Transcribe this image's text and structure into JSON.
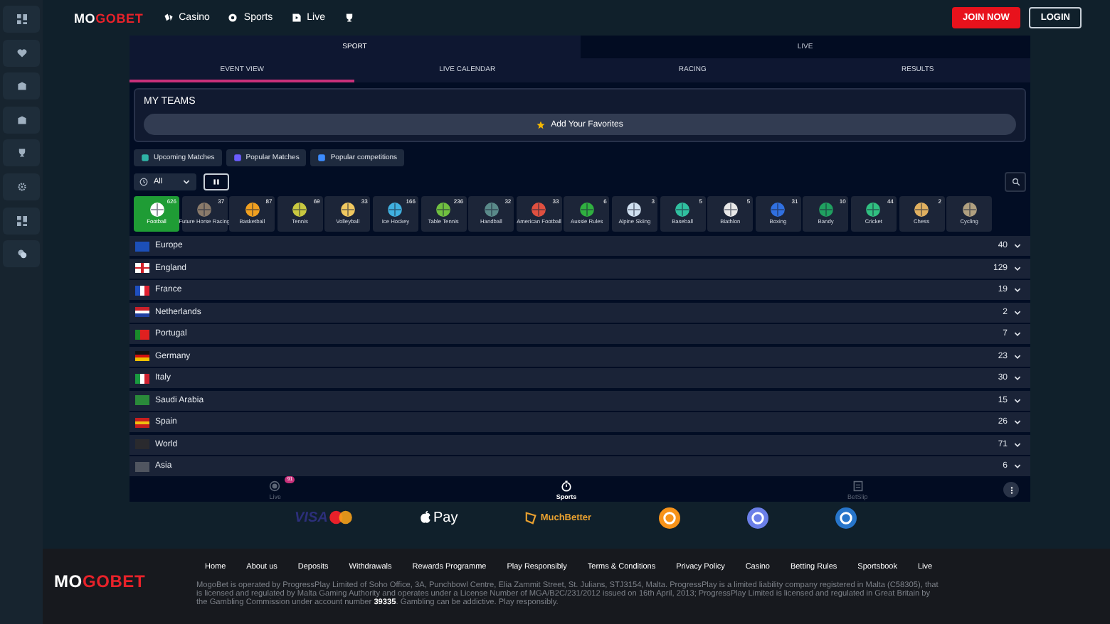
{
  "top_bar": {
    "logo": {
      "light": "MO",
      "accent": "GOBET"
    },
    "nav": [
      {
        "kind": "link",
        "label": "Casino"
      },
      {
        "kind": "link",
        "label": "Sports"
      },
      {
        "kind": "link",
        "label": "Live"
      },
      {
        "kind": "icon"
      }
    ],
    "buttons": [
      {
        "kind": "primary",
        "label": "JOIN NOW"
      },
      {
        "kind": "outline",
        "label": "LOGIN"
      }
    ]
  },
  "main_tabs": [
    {
      "label": "SPORT",
      "selected": true
    },
    {
      "label": "LIVE",
      "selected": false
    }
  ],
  "sub_tabs": [
    {
      "label": "EVENT VIEW",
      "selected": true
    },
    {
      "label": "LIVE CALENDAR",
      "selected": false
    },
    {
      "label": "RACING",
      "selected": false
    },
    {
      "label": "RESULTS",
      "selected": false
    }
  ],
  "my_teams": {
    "title": "MY TEAMS",
    "button": "Add Your Favorites"
  },
  "quick_filters": [
    {
      "label": "Upcoming Matches",
      "color": "#2fb3a6"
    },
    {
      "label": "Popular Matches",
      "color": "#6b5cff"
    },
    {
      "label": "Popular competitions",
      "color": "#3c8cff"
    }
  ],
  "time_filter": {
    "value": "All"
  },
  "sports": [
    {
      "name": "Football",
      "count": "626",
      "color": "#ffffff",
      "selected": true
    },
    {
      "name": "Future Horse Racing",
      "count": "37",
      "color": "#8a7a6a",
      "selected": false
    },
    {
      "name": "Basketball",
      "count": "87",
      "color": "#f0a020",
      "selected": false
    },
    {
      "name": "Tennis",
      "count": "69",
      "color": "#c8c840",
      "selected": false
    },
    {
      "name": "Volleyball",
      "count": "33",
      "color": "#f0c860",
      "selected": false
    },
    {
      "name": "Ice Hockey",
      "count": "166",
      "color": "#40b0e0",
      "selected": false
    },
    {
      "name": "Table Tennis",
      "count": "236",
      "color": "#70c040",
      "selected": false
    },
    {
      "name": "Handball",
      "count": "32",
      "color": "#5a8a8a",
      "selected": false
    },
    {
      "name": "American Football",
      "count": "33",
      "color": "#e05040",
      "selected": false
    },
    {
      "name": "Aussie Rules",
      "count": "6",
      "color": "#30b040",
      "selected": false
    },
    {
      "name": "Alpine Skiing",
      "count": "3",
      "color": "#d0e0f0",
      "selected": false
    },
    {
      "name": "Baseball",
      "count": "5",
      "color": "#30c0a0",
      "selected": false
    },
    {
      "name": "Biathlon",
      "count": "5",
      "color": "#e8e8e8",
      "selected": false
    },
    {
      "name": "Boxing",
      "count": "31",
      "color": "#3070e0",
      "selected": false
    },
    {
      "name": "Bandy",
      "count": "10",
      "color": "#20a060",
      "selected": false
    },
    {
      "name": "Cricket",
      "count": "44",
      "color": "#30c080",
      "selected": false
    },
    {
      "name": "Chess",
      "count": "2",
      "color": "#e0b060",
      "selected": false
    },
    {
      "name": "Cycling",
      "color": "#b0a080",
      "selected": false
    }
  ],
  "regions": [
    {
      "kind": "eu",
      "name": "Europe",
      "count": "40"
    },
    {
      "kind": "england",
      "name": "England",
      "count": "129"
    },
    {
      "kind": "france",
      "name": "France",
      "count": "19"
    },
    {
      "kind": "netherlands",
      "name": "Netherlands",
      "count": "2"
    },
    {
      "kind": "portugal",
      "name": "Portugal",
      "count": "7"
    },
    {
      "kind": "germany",
      "name": "Germany",
      "count": "23"
    },
    {
      "kind": "italy",
      "name": "Italy",
      "count": "30"
    },
    {
      "kind": "saudi",
      "name": "Saudi Arabia",
      "count": "15"
    },
    {
      "kind": "spain",
      "name": "Spain",
      "count": "26"
    },
    {
      "kind": "world",
      "name": "World",
      "count": "71"
    },
    {
      "kind": "asia",
      "name": "Asia",
      "count": "6"
    }
  ],
  "bottom_nav": [
    {
      "label": "Live",
      "badge": "91",
      "selected": false
    },
    {
      "label": "Sports",
      "selected": true
    },
    {
      "label": "BetSlip",
      "selected": false
    }
  ],
  "payments": [
    {
      "kind": "visa",
      "label": "VISA"
    },
    {
      "kind": "applepay",
      "label": "Pay"
    },
    {
      "kind": "muchbetter",
      "label": "MuchBetter"
    },
    {
      "kind": "coin",
      "color": "#f7931a"
    },
    {
      "kind": "coin",
      "color": "#6b7fe8"
    },
    {
      "kind": "coin",
      "color": "#2775ca"
    }
  ],
  "footer": {
    "logo": {
      "light": "MO",
      "accent": "GOBET"
    },
    "links": [
      "Home",
      "About us",
      "Deposits",
      "Withdrawals",
      "Rewards Programme",
      "Play Responsibly",
      "Terms & Conditions",
      "Privacy Policy",
      "Casino",
      "Betting Rules",
      "Sportsbook",
      "Live"
    ],
    "text": "MogoBet is operated by ProgressPlay Limited of Soho Office, 3A, Punchbowl Centre, Elia Zammit Street, St. Julians, STJ3154, Malta. ProgressPlay is a limited liability company registered in Malta (C58305), that is licensed and regulated by Malta Gaming Authority and operates under a License Number of MGA/B2C/231/2012 issued on 16th April, 2013; ProgressPlay Limited is licensed and regulated in Great Britain by the Gambling Commission under account number **39335**. Gambling can be addictive. Play responsibly."
  }
}
